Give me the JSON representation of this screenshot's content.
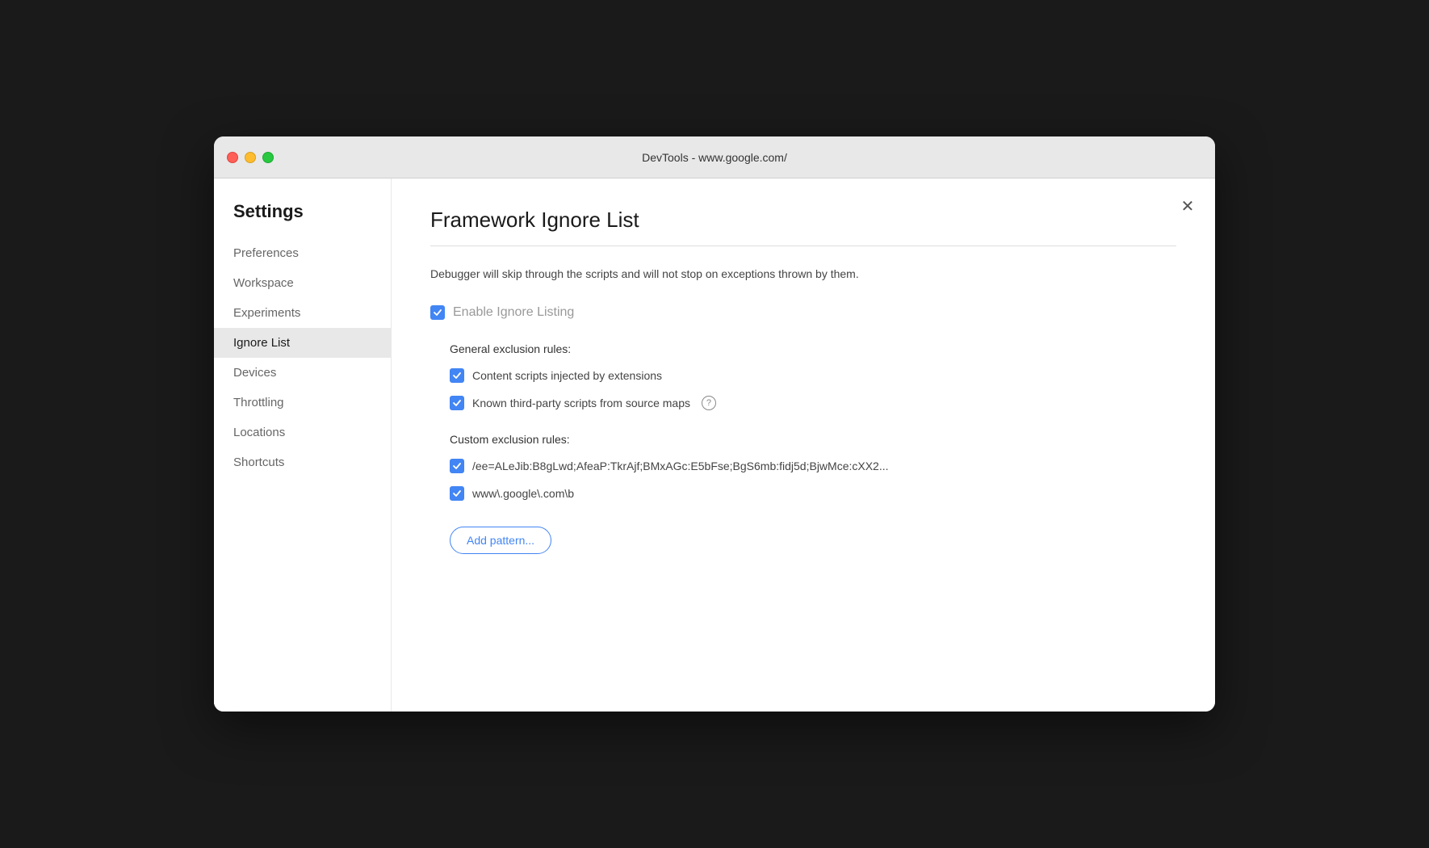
{
  "titlebar": {
    "title": "DevTools - www.google.com/"
  },
  "sidebar": {
    "heading": "Settings",
    "items": [
      {
        "id": "preferences",
        "label": "Preferences",
        "active": false
      },
      {
        "id": "workspace",
        "label": "Workspace",
        "active": false
      },
      {
        "id": "experiments",
        "label": "Experiments",
        "active": false
      },
      {
        "id": "ignore-list",
        "label": "Ignore List",
        "active": true
      },
      {
        "id": "devices",
        "label": "Devices",
        "active": false
      },
      {
        "id": "throttling",
        "label": "Throttling",
        "active": false
      },
      {
        "id": "locations",
        "label": "Locations",
        "active": false
      },
      {
        "id": "shortcuts",
        "label": "Shortcuts",
        "active": false
      }
    ]
  },
  "main": {
    "page_title": "Framework Ignore List",
    "description": "Debugger will skip through the scripts and will not stop on exceptions thrown by them.",
    "enable_label": "Enable Ignore Listing",
    "general_section_label": "General exclusion rules:",
    "general_rules": [
      {
        "id": "content-scripts",
        "label": "Content scripts injected by extensions",
        "checked": true,
        "has_help": false
      },
      {
        "id": "third-party-scripts",
        "label": "Known third-party scripts from source maps",
        "checked": true,
        "has_help": true
      }
    ],
    "custom_section_label": "Custom exclusion rules:",
    "custom_rules": [
      {
        "id": "custom-rule-1",
        "label": "/ee=ALeJib:B8gLwd;AfeaP:TkrAjf;BMxAGc:E5bFse;BgS6mb:fidj5d;BjwMce:cXX2...",
        "checked": true
      },
      {
        "id": "custom-rule-2",
        "label": "www\\.google\\.com\\b",
        "checked": true
      }
    ],
    "add_pattern_label": "Add pattern..."
  }
}
